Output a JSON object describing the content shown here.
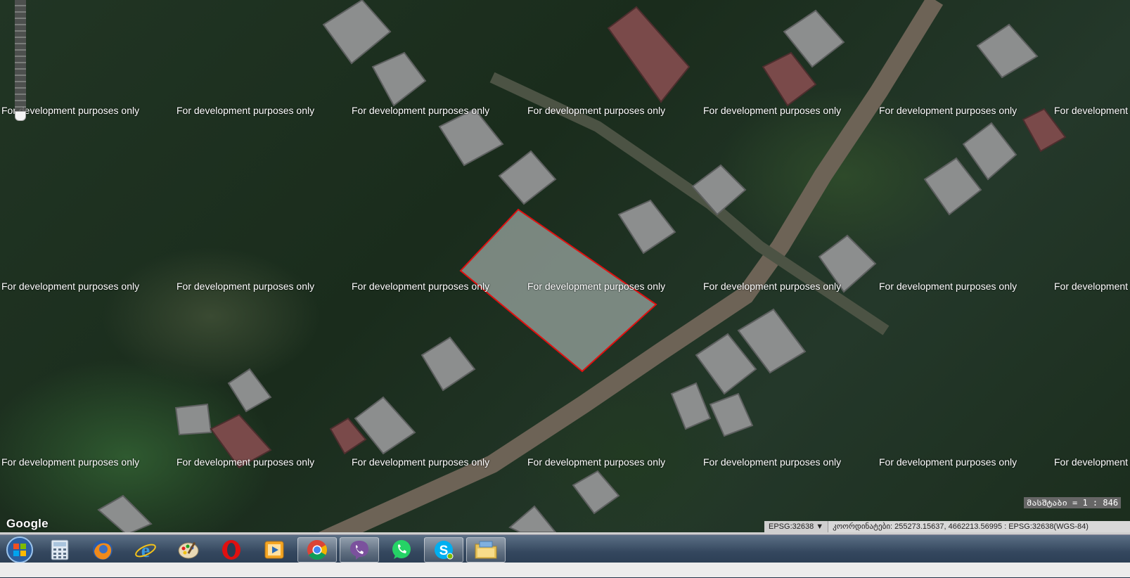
{
  "map": {
    "watermark_text": "For development purposes only",
    "attribution": "Google",
    "scale_text": "მასშტაბი = 1 : 846",
    "polygon_stroke_color": "#e01010",
    "polygon_fill_color": "#9aa5a0"
  },
  "status_bar": {
    "projection_select": "EPSG:32638 ▼",
    "coordinates": "კოორდინატები: 255273.15637, 4662213.56995 : EPSG:32638(WGS-84)"
  },
  "taskbar": {
    "items": [
      {
        "icon": "windows-start-icon"
      },
      {
        "icon": "calculator-icon"
      },
      {
        "icon": "firefox-icon"
      },
      {
        "icon": "internet-explorer-icon"
      },
      {
        "icon": "paint-icon"
      },
      {
        "icon": "opera-icon"
      },
      {
        "icon": "media-player-icon"
      },
      {
        "icon": "chrome-icon",
        "active": true
      },
      {
        "icon": "viber-icon",
        "active": true
      },
      {
        "icon": "whatsapp-icon"
      },
      {
        "icon": "skype-icon",
        "active": true
      },
      {
        "icon": "file-explorer-icon",
        "active": true
      }
    ]
  }
}
